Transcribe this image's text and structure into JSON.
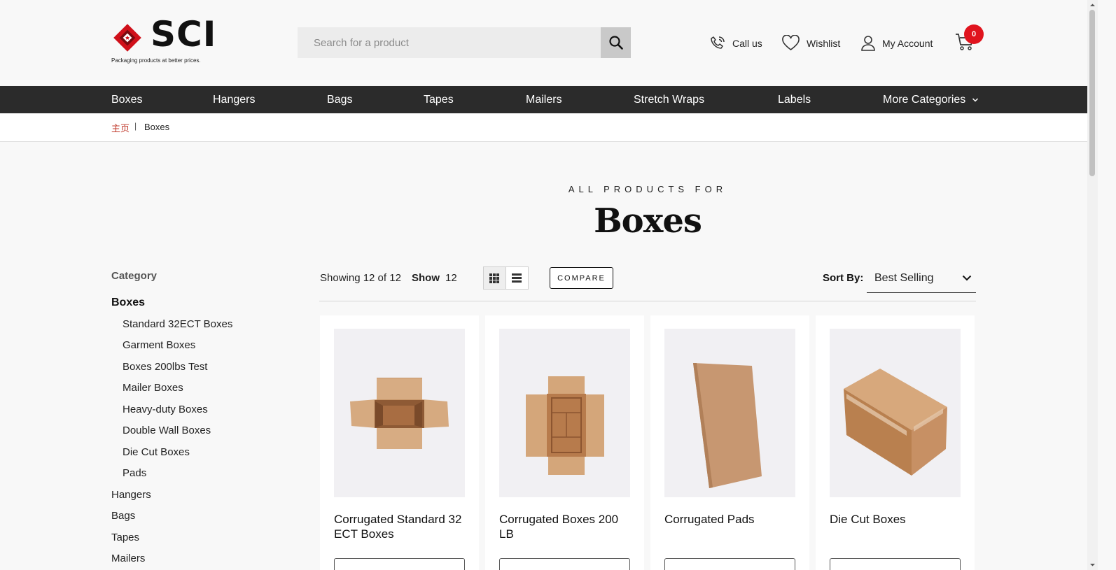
{
  "header": {
    "brand": "SCI",
    "tagline": "Packaging products at better prices.",
    "search_placeholder": "Search for a product",
    "call_label": "Call us",
    "wishlist_label": "Wishlist",
    "account_label": "My Account",
    "cart_count": "0",
    "accent_color": "#e0141e"
  },
  "nav": {
    "items": [
      "Boxes",
      "Hangers",
      "Bags",
      "Tapes",
      "Mailers",
      "Stretch Wraps",
      "Labels",
      "More Categories"
    ]
  },
  "breadcrumb": {
    "home": "主页",
    "separator": "|",
    "current": "Boxes"
  },
  "hero": {
    "kicker": "ALL PRODUCTS FOR",
    "title": "Boxes"
  },
  "sidebar": {
    "heading": "Category",
    "active": "Boxes",
    "subcategories": [
      "Standard 32ECT Boxes",
      "Garment Boxes",
      "Boxes 200lbs Test",
      "Mailer Boxes",
      "Heavy-duty Boxes",
      "Double Wall Boxes",
      "Die Cut Boxes",
      "Pads"
    ],
    "categories": [
      "Hangers",
      "Bags",
      "Tapes",
      "Mailers"
    ]
  },
  "toolbar": {
    "showing": "Showing 12 of 12",
    "show_label": "Show",
    "show_value": "12",
    "compare_label": "COMPARE",
    "sort_label": "Sort By:",
    "sort_value": "Best Selling"
  },
  "products": [
    {
      "name": "Corrugated Standard 32 ECT Boxes",
      "image": "open-box-top-view"
    },
    {
      "name": "Corrugated Boxes 200 LB",
      "image": "open-box-flaps-top-view"
    },
    {
      "name": "Corrugated Pads",
      "image": "corrugated-pad-sheet"
    },
    {
      "name": "Die Cut Boxes",
      "image": "closed-taped-box"
    }
  ]
}
